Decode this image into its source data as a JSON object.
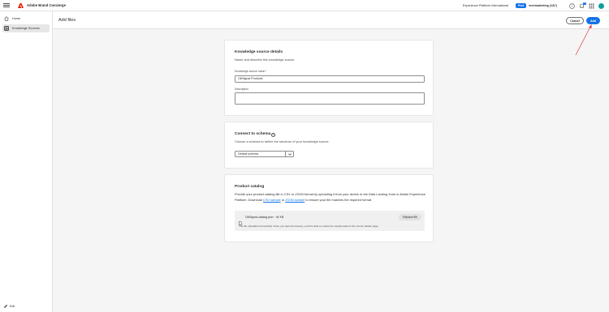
{
  "app": {
    "title": "Adobe Brand Concierge",
    "org": "Experience Platform International",
    "env_badge": "Prod",
    "sandbox": "techmarketing (VA7)",
    "notifications_count": "1",
    "icons": [
      "menu-icon",
      "adobe-logo-icon",
      "help-icon",
      "bell-icon",
      "apps-grid-icon",
      "avatar"
    ]
  },
  "sidebar": {
    "items": [
      {
        "label": "Home",
        "icon": "home-icon"
      },
      {
        "label": "Knowledge Sources",
        "icon": "knowledge-sources-icon"
      }
    ],
    "edit_label": "Edit"
  },
  "header": {
    "title": "Add files",
    "cancel_label": "Cancel",
    "add_label": "Add"
  },
  "details_card": {
    "title": "Knowledge source details",
    "subtitle": "Name and describe this knowledge source.",
    "name_label": "Knowledge source name *",
    "name_value": "CitiSignal Products",
    "description_label": "Description",
    "description_value": ""
  },
  "schema_card": {
    "title": "Connect to schema",
    "info_icon": "i",
    "subtitle": "Choose a schema to define the structure of your knowledge source.",
    "select_value": "Default schema"
  },
  "catalog_card": {
    "title": "Product catalog",
    "desc_part1": "Provide your product catalog file in CSV or JSON format by uploading it from your device or the Data Landing Zone in Adobe Experience Platform. Download ",
    "csv_link": "CSV sample",
    "desc_or": " or ",
    "json_link": "JSON sample",
    "desc_part2": " to ensure your file matches the required format.",
    "file_name": "CitiSignal-catalog.json · 94 KB",
    "replace_label": "Replace file",
    "upload_message": "The file uploaded successfully. Once you start processing, you'll be able to review the sample data on the source details page."
  },
  "colors": {
    "accent": "#1473e6",
    "annotation": "#e03a3e"
  }
}
